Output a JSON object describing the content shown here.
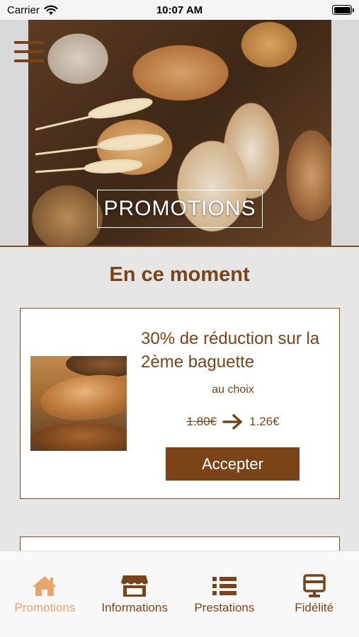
{
  "status_bar": {
    "carrier": "Carrier",
    "time": "10:07 AM"
  },
  "hero": {
    "title": "PROMOTIONS",
    "menu_icon": "hamburger-menu-icon"
  },
  "section": {
    "title": "En ce moment"
  },
  "promo": {
    "title": "30% de réduction sur la 2ème baguette",
    "subtitle": "au choix",
    "old_price": "1.80€",
    "new_price": "1.26€",
    "accept_label": "Accepter"
  },
  "tabs": [
    {
      "label": "Promotions",
      "icon": "home-icon",
      "active": true
    },
    {
      "label": "Informations",
      "icon": "store-icon",
      "active": false
    },
    {
      "label": "Prestations",
      "icon": "list-icon",
      "active": false
    },
    {
      "label": "Fidélité",
      "icon": "loyalty-card-icon",
      "active": false
    }
  ],
  "colors": {
    "brand_brown": "#7a4418",
    "active_tab": "#e8a46a",
    "background": "#e6e6e6"
  }
}
